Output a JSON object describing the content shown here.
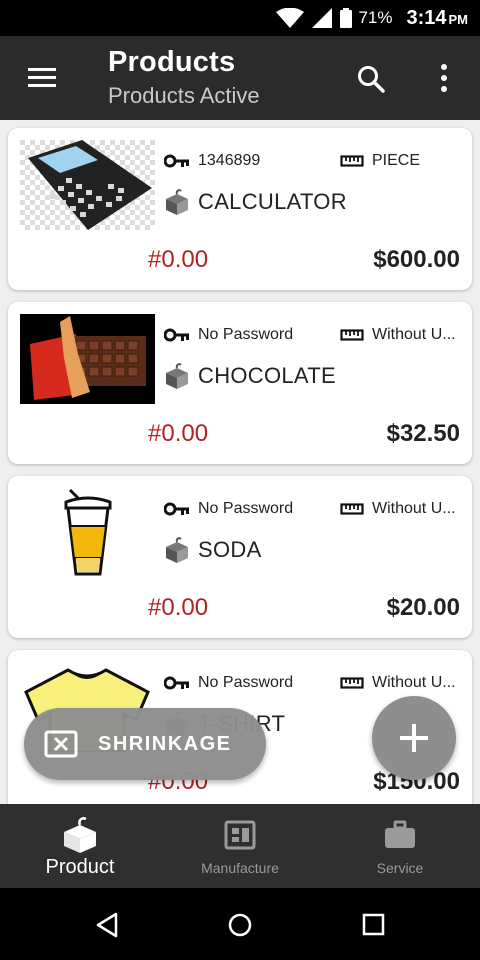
{
  "status_bar": {
    "battery": "71%",
    "time": "3:14",
    "ampm": "PM"
  },
  "app_bar": {
    "title": "Products",
    "subtitle": "Products Active"
  },
  "products": [
    {
      "code": "1346899",
      "unit": "PIECE",
      "name": "CALCULATOR",
      "cost": "#0.00",
      "price": "$600.00",
      "image": "calculator"
    },
    {
      "code": "No Password",
      "unit": "Without U...",
      "name": "CHOCOLATE",
      "cost": "#0.00",
      "price": "$32.50",
      "image": "chocolate"
    },
    {
      "code": "No Password",
      "unit": "Without U...",
      "name": "SODA",
      "cost": "#0.00",
      "price": "$20.00",
      "image": "soda"
    },
    {
      "code": "No Password",
      "unit": "Without U...",
      "name": "T-SHIRT",
      "cost": "#0.00",
      "price": "$150.00",
      "image": "t-shirt"
    }
  ],
  "shrinkage_button": {
    "label": "SHRINKAGE"
  },
  "bottom_nav": [
    {
      "label": "Product",
      "icon": "product-icon",
      "active": true
    },
    {
      "label": "Manufacture",
      "icon": "manufacture-icon",
      "active": false
    },
    {
      "label": "Service",
      "icon": "service-icon",
      "active": false
    }
  ],
  "colors": {
    "app_bar": "#2b2b2b",
    "cost": "#b22222",
    "fab": "#8e8e8e",
    "bottom_nav": "#2f2f2f"
  }
}
